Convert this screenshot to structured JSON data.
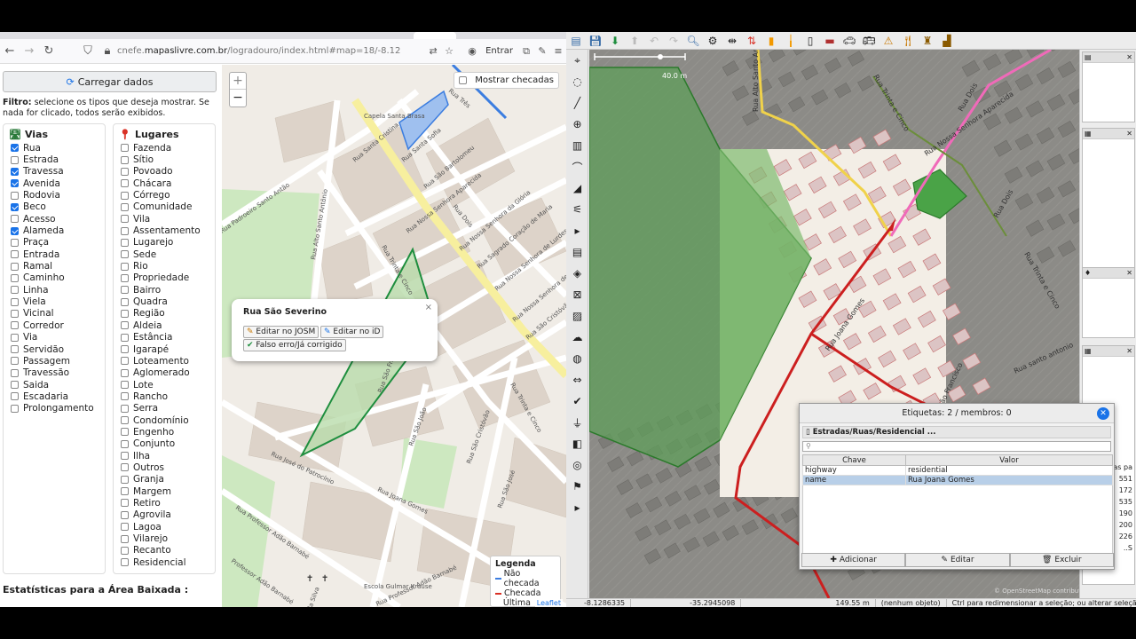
{
  "browser": {
    "url_prefix": "cnefe.",
    "url_domain": "mapaslivre.com.br",
    "url_path": "/logradouro/index.html#map=18/-8.12",
    "signin_label": "Entrar"
  },
  "sidebar": {
    "load_button": "Carregar dados",
    "filter_label": "Filtro:",
    "filter_text": " selecione os tipos que deseja mostrar. Se nada for clicado, todos serão exibidos.",
    "vias_title": "Vias",
    "lugares_title": "Lugares",
    "vias": [
      {
        "label": "Rua",
        "checked": true
      },
      {
        "label": "Estrada",
        "checked": false
      },
      {
        "label": "Travessa",
        "checked": true
      },
      {
        "label": "Avenida",
        "checked": true
      },
      {
        "label": "Rodovia",
        "checked": false
      },
      {
        "label": "Beco",
        "checked": true
      },
      {
        "label": "Acesso",
        "checked": false
      },
      {
        "label": "Alameda",
        "checked": true
      },
      {
        "label": "Praça",
        "checked": false
      },
      {
        "label": "Entrada",
        "checked": false
      },
      {
        "label": "Ramal",
        "checked": false
      },
      {
        "label": "Caminho",
        "checked": false
      },
      {
        "label": "Linha",
        "checked": false
      },
      {
        "label": "Viela",
        "checked": false
      },
      {
        "label": "Vicinal",
        "checked": false
      },
      {
        "label": "Corredor",
        "checked": false
      },
      {
        "label": "Via",
        "checked": false
      },
      {
        "label": "Servidão",
        "checked": false
      },
      {
        "label": "Passagem",
        "checked": false
      },
      {
        "label": "Travessão",
        "checked": false
      },
      {
        "label": "Saida",
        "checked": false
      },
      {
        "label": "Escadaria",
        "checked": false
      },
      {
        "label": "Prolongamento",
        "checked": false
      }
    ],
    "lugares": [
      "Fazenda",
      "Sítio",
      "Povoado",
      "Chácara",
      "Córrego",
      "Comunidade",
      "Vila",
      "Assentamento",
      "Lugarejo",
      "Sede",
      "Rio",
      "Propriedade",
      "Bairro",
      "Quadra",
      "Região",
      "Aldeia",
      "Estância",
      "Igarapé",
      "Loteamento",
      "Aglomerado",
      "Lote",
      "Rancho",
      "Serra",
      "Condomínio",
      "Engenho",
      "Conjunto",
      "Ilha",
      "Outros",
      "Granja",
      "Margem",
      "Retiro",
      "Agrovila",
      "Lagoa",
      "Vilarejo",
      "Recanto",
      "Residencial"
    ],
    "stats_title": "Estatísticas para a Área Baixada :"
  },
  "map": {
    "show_checked_label": "Mostrar checadas",
    "popup": {
      "title": "Rua São Severino",
      "edit_josm": "Editar no JOSM",
      "edit_id": "Editar no iD",
      "false_error": "Falso erro/Já corrigido"
    },
    "legend": {
      "title": "Legenda",
      "items": [
        {
          "label": "Não checada",
          "color": "#3b7de0"
        },
        {
          "label": "Checada",
          "color": "#d93025"
        },
        {
          "label": "Última editada",
          "color": "#1e8e3e"
        }
      ]
    },
    "street_labels": [
      "Rua Três",
      "Rua Santa Cristina",
      "Rua Santa Sofia",
      "Rua São Bartolomeu",
      "Rua Dois",
      "Rua Nossa Senhora da Glória",
      "Rua Sagrado Coração de Maria",
      "Rua Nossa Senhora de Lurdes",
      "Rua Nossa Senhora de Fátima",
      "Rua São Cristóvão",
      "Rua Trinta e Cinco",
      "Rua Padroeiro Santo Antão",
      "Rua Alto Santo Antônio",
      "Rua Trinta e Cinco",
      "Rua Nossa Senhora Aparecida",
      "Rua São Francisco",
      "Rua José do Patrocínio",
      "Rua São João",
      "Rua São Cristóvão",
      "Rua Joana Gomes",
      "Rua São José",
      "Rua Professor Adão Barnabé",
      "Professor Adão Barnabé",
      "Rua Professor Adão Barnabé",
      "Rua da Silva",
      "Capela Santa Brasa",
      "Escola Gulmar Krause"
    ],
    "leaflet": "Leaflet"
  },
  "josm": {
    "scale_label": "40.0 m",
    "street_labels": [
      "Rua Alto Santo Antônio",
      "Rua Trinta e Cinco",
      "Rua Nossa Senhora Aparecida",
      "Rua Dois",
      "Rua Joana Gomes",
      "Rua São Francisco",
      "Rua santo antonio",
      "Rua Trinta e Cinco",
      "Rua Dois"
    ],
    "attribution": "© OpenStreetMap contributors",
    "tag_dialog": {
      "title": "Etiquetas: 2 / membros: 0",
      "subtitle": "Estradas/Ruas/Residencial ...",
      "col_key": "Chave",
      "col_value": "Valor",
      "rows": [
        {
          "key": "highway",
          "value": "residential",
          "selected": false
        },
        {
          "key": "name",
          "value": "Rua Joana Gomes",
          "selected": true
        }
      ],
      "btn_add": "Adicionar",
      "btn_edit": "Editar",
      "btn_delete": "Excluir"
    },
    "status": {
      "lat": "-8.1286335",
      "lon": "-35.2945098",
      "dist": "149.55 m",
      "obj": "(nenhum objeto)",
      "hint": "Ctrl para redimensionar a seleção; ou alterar seleção"
    },
    "right_partial": [
      "as pa",
      "551",
      "172",
      "535",
      "190",
      "200",
      "226",
      "..S"
    ]
  }
}
